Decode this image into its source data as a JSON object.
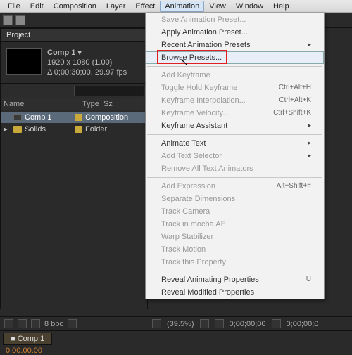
{
  "menubar": {
    "items": [
      "File",
      "Edit",
      "Composition",
      "Layer",
      "Effect",
      "Animation",
      "View",
      "Window",
      "Help"
    ],
    "active_index": 5
  },
  "project": {
    "tab": "Project",
    "comp": {
      "name": "Comp 1 ▾",
      "dims": "1920 x 1080 (1.00)",
      "dur": "Δ 0;00;30;00, 29.97 fps"
    },
    "search_placeholder": "",
    "cols": [
      "Name",
      "Type",
      "Sz"
    ],
    "items": [
      {
        "name": "Comp 1",
        "type": "Composition",
        "selected": true,
        "kind": "comp"
      },
      {
        "name": "Solids",
        "type": "Folder",
        "selected": false,
        "kind": "folder"
      }
    ]
  },
  "menu": [
    {
      "t": "Save Animation Preset...",
      "d": true
    },
    {
      "t": "Apply Animation Preset..."
    },
    {
      "t": "Recent Animation Presets",
      "sub": true
    },
    {
      "t": "Browse Presets...",
      "hl": true,
      "red": true
    },
    {
      "sep": true
    },
    {
      "t": "Add Keyframe",
      "d": true
    },
    {
      "t": "Toggle Hold Keyframe",
      "s": "Ctrl+Alt+H",
      "d": true
    },
    {
      "t": "Keyframe Interpolation...",
      "s": "Ctrl+Alt+K",
      "d": true
    },
    {
      "t": "Keyframe Velocity...",
      "s": "Ctrl+Shift+K",
      "d": true
    },
    {
      "t": "Keyframe Assistant",
      "sub": true
    },
    {
      "sep": true
    },
    {
      "t": "Animate Text",
      "sub": true
    },
    {
      "t": "Add Text Selector",
      "sub": true,
      "d": true
    },
    {
      "t": "Remove All Text Animators",
      "d": true
    },
    {
      "sep": true
    },
    {
      "t": "Add Expression",
      "s": "Alt+Shift+=",
      "d": true
    },
    {
      "t": "Separate Dimensions",
      "d": true
    },
    {
      "t": "Track Camera",
      "d": true
    },
    {
      "t": "Track in mocha AE",
      "d": true
    },
    {
      "t": "Warp Stabilizer",
      "d": true
    },
    {
      "t": "Track Motion",
      "d": true
    },
    {
      "t": "Track this Property",
      "d": true
    },
    {
      "sep": true
    },
    {
      "t": "Reveal Animating Properties",
      "s": "U"
    },
    {
      "t": "Reveal Modified Properties"
    }
  ],
  "status": {
    "bpc": "8 bpc"
  },
  "viewer": {
    "zoom": "(39.5%)",
    "time": "0;00;00;00",
    "time2": "0;00;00;0"
  },
  "timeline": {
    "tab": "Comp 1",
    "time": "0:00:00:00"
  }
}
